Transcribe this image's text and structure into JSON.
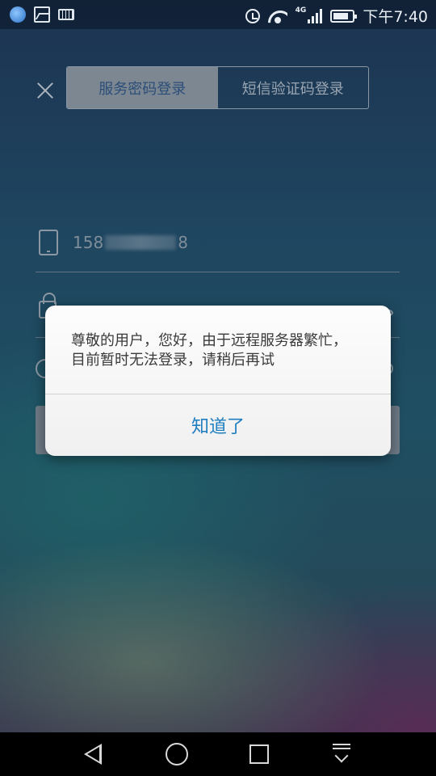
{
  "status_bar": {
    "time": "下午7:40",
    "network": "4G"
  },
  "login_tabs": [
    {
      "label": "服务密码登录",
      "active": true
    },
    {
      "label": "短信验证码登录",
      "active": false
    }
  ],
  "phone_field": {
    "prefix": "158",
    "suffix": "8"
  },
  "dialog": {
    "message_line1": "尊敬的用户，您好，由于远程服务器繁忙，",
    "message_line2": "目前暂时无法登录，请稍后再试",
    "button_label": "知道了"
  },
  "colors": {
    "tab_active_bg": "#7d8791",
    "tab_active_text": "#2b4e79",
    "dialog_button_text": "#1e7ec0",
    "dialog_bg": "#f6f6f6"
  }
}
